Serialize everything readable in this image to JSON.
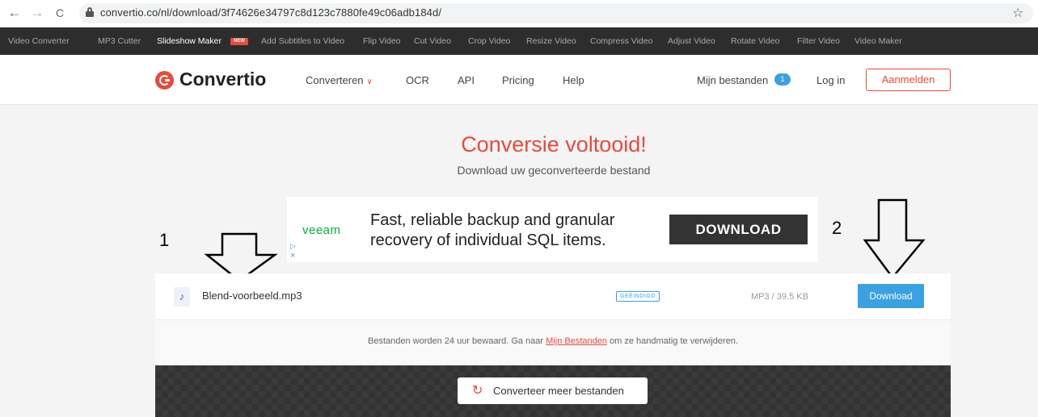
{
  "browser": {
    "back_icon": "←",
    "forward_icon": "→",
    "reload_icon": "C",
    "url": "convertio.co/nl/download/3f74626e34797c8d123c7880fe49c06adb184d/",
    "star_icon": "☆"
  },
  "tools": {
    "items": [
      "Video Converter",
      "MP3 Cutter",
      "Slideshow Maker",
      "Add Subtitles to Video",
      "Flip Video",
      "Cut Video",
      "Crop Video",
      "Resize Video",
      "Compress Video",
      "Adjust Video",
      "Rotate Video",
      "Filter Video",
      "Video Maker"
    ],
    "new_badge": "NEW"
  },
  "header": {
    "logo": "Convertio",
    "menu": {
      "converteren": "Converteren",
      "chevron": "∨",
      "ocr": "OCR",
      "api": "API",
      "pricing": "Pricing",
      "help": "Help"
    },
    "my_files": "Mijn bestanden",
    "my_files_count": "1",
    "login": "Log in",
    "signup": "Aanmelden"
  },
  "main": {
    "title": "Conversie voltooid!",
    "subtitle": "Download uw geconverteerde bestand"
  },
  "ad": {
    "brand": "veeam",
    "line1": "Fast, reliable backup and granular",
    "line2": "recovery of individual SQL items.",
    "cta": "DOWNLOAD",
    "play_icon": "▷",
    "close_icon": "×"
  },
  "annotations": {
    "label_1": "1",
    "label_2": "2"
  },
  "file": {
    "icon": "♪",
    "name": "Blend-voorbeeld.mp3",
    "status": "GEËINDIGD",
    "meta": "MP3 / 39.5 KB",
    "download": "Download"
  },
  "note": {
    "before": "Bestanden worden 24 uur bewaard. Ga naar ",
    "link": "Mijn Bestanden",
    "after": " om ze handmatig te verwijderen."
  },
  "more": {
    "icon": "↻",
    "label": "Converteer meer bestanden"
  },
  "colors": {
    "accent_red": "#e64b3b",
    "accent_blue": "#3ba1e0",
    "veeam_green": "#00b336"
  }
}
